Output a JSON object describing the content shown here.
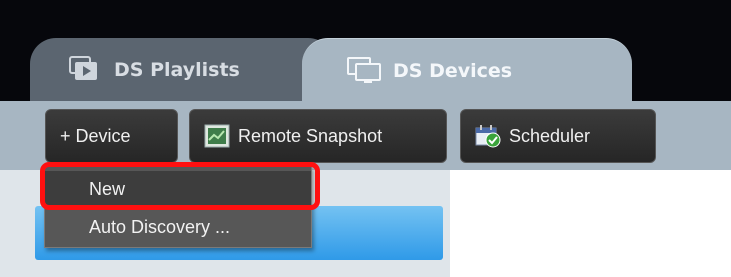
{
  "tabs": [
    {
      "label": "DS Playlists",
      "icon": "playlist-icon"
    },
    {
      "label": "DS Devices",
      "icon": "devices-icon"
    }
  ],
  "toolbar": {
    "device_label": "+ Device",
    "snapshot_label": "Remote Snapshot",
    "snapshot_icon": "snapshot-icon",
    "scheduler_label": "Scheduler",
    "scheduler_icon": "calendar-icon"
  },
  "menu": {
    "items": [
      {
        "label": "New",
        "highlighted": true
      },
      {
        "label": "Auto Discovery ..."
      }
    ]
  },
  "colors": {
    "tab_active": "#a7b6c2",
    "tab_inactive": "#5b6570",
    "selection_blue": "#3a9fe9",
    "highlight_red": "#ff1010"
  }
}
